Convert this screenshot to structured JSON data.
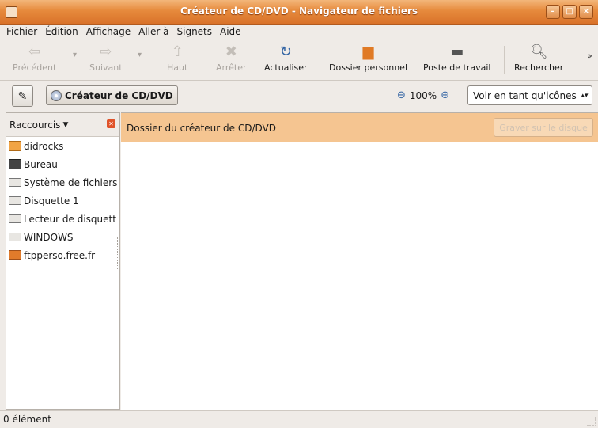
{
  "window": {
    "title": "Créateur de CD/DVD - Navigateur de fichiers",
    "accent": "#e68a3c"
  },
  "menu": [
    "Fichier",
    "Édition",
    "Affichage",
    "Aller à",
    "Signets",
    "Aide"
  ],
  "toolbar": {
    "back": "Précédent",
    "forward": "Suivant",
    "up": "Haut",
    "stop": "Arrêter",
    "reload": "Actualiser",
    "home": "Dossier personnel",
    "computer": "Poste de travail",
    "search": "Rechercher"
  },
  "location": {
    "path_button": "Créateur de CD/DVD",
    "zoom": "100%",
    "view_mode": "Voir en tant qu'icônes"
  },
  "sidebar": {
    "header": "Raccourcis",
    "items": [
      {
        "label": "didrocks",
        "icon": "home-folder-icon"
      },
      {
        "label": "Bureau",
        "icon": "desktop-icon"
      },
      {
        "label": "Système de fichiers",
        "icon": "drive-icon"
      },
      {
        "label": "Disquette 1",
        "icon": "drive-icon"
      },
      {
        "label": "Lecteur de disquett",
        "icon": "drive-icon"
      },
      {
        "label": "WINDOWS",
        "icon": "drive-icon"
      },
      {
        "label": "ftpperso.free.fr",
        "icon": "ftp-icon"
      }
    ]
  },
  "content": {
    "banner_text": "Dossier du créateur de CD/DVD",
    "burn_button": "Graver sur le disque"
  },
  "status": {
    "text": "0 élément"
  }
}
